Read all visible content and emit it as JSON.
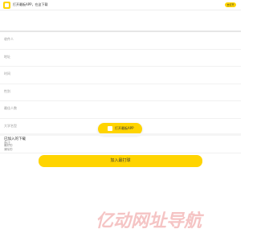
{
  "topbar": {
    "title": "打开最板APP，在这下载",
    "open_button": "去打开"
  },
  "form": {
    "fields": [
      {
        "label": "收件人"
      },
      {
        "label": "地址"
      },
      {
        "label": "时间"
      },
      {
        "label": "性别"
      },
      {
        "label": "最佳人数"
      },
      {
        "label": "大学名型"
      },
      {
        "label": "备注"
      }
    ]
  },
  "floating_button": {
    "label": "打开最板APP"
  },
  "section": {
    "title": "已加入的下载",
    "line1": "最好的",
    "line2": "清除的"
  },
  "join_button": {
    "label": "加入最打球"
  },
  "watermark": {
    "text": "亿动网址导航"
  },
  "colors": {
    "accent": "#ffd400",
    "watermark": "#f0a5a5"
  }
}
